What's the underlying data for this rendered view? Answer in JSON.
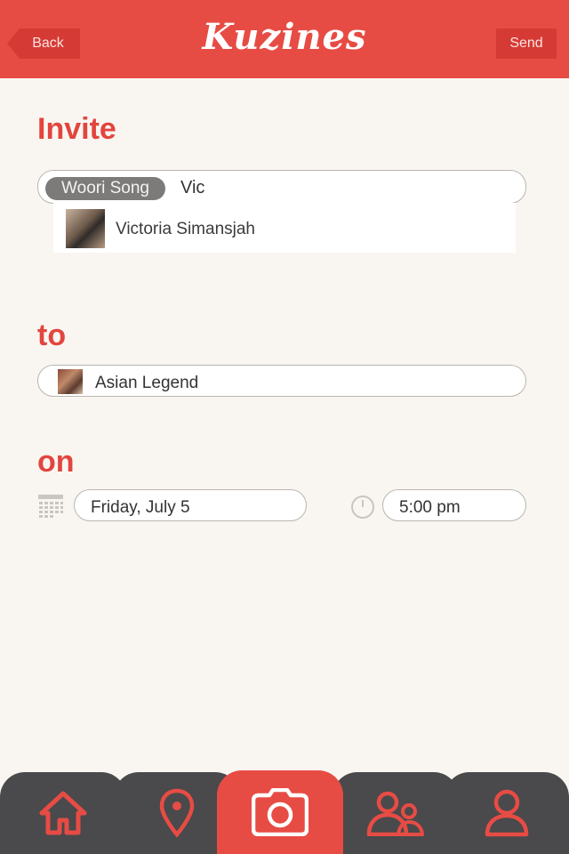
{
  "header": {
    "back_label": "Back",
    "title": "Kuzines",
    "send_label": "Send"
  },
  "invite": {
    "title": "Invite",
    "chip_label": "Woori Song",
    "typed_text": "Vic",
    "suggestion_name": "Victoria Simansjah"
  },
  "to": {
    "title": "to",
    "place_name": "Asian Legend"
  },
  "on": {
    "title": "on",
    "date_value": "Friday, July 5",
    "time_value": "5:00 pm"
  },
  "tabbar": {
    "tabs": [
      "home-icon",
      "map-pin-icon",
      "camera-icon",
      "friends-icon",
      "profile-icon"
    ],
    "active_index": 2
  },
  "colors": {
    "accent": "#e74c44",
    "tab_dark": "#4a494b",
    "background": "#f9f6f1"
  }
}
